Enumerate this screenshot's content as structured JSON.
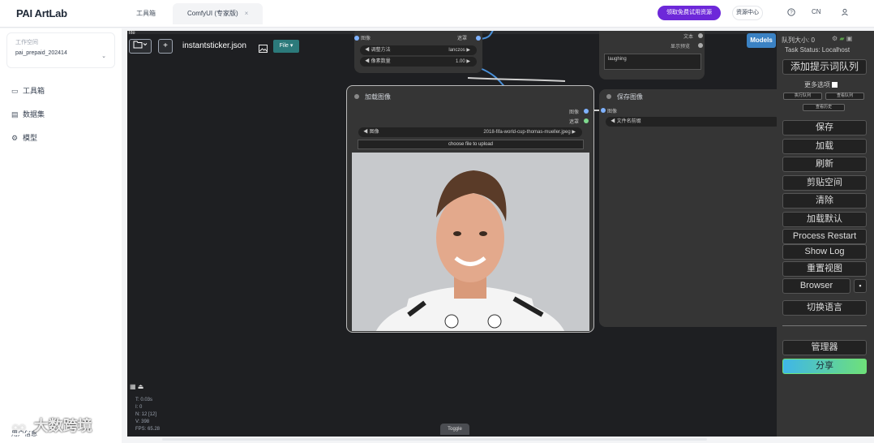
{
  "app": {
    "brand": "PAI ArtLab"
  },
  "tabs": [
    {
      "label": "工具箱"
    },
    {
      "label": "ComfyUI (专家版)",
      "close": "×"
    }
  ],
  "header": {
    "cta_label": "领取免费试用资源",
    "pill_label": "资源中心",
    "lang": "CN",
    "help_icon": "question-icon",
    "user_icon": "user-icon"
  },
  "sidebar": {
    "workspace_label": "工作空间",
    "workspace_value": "pai_prepaid_202414",
    "items": [
      {
        "label": "工具箱",
        "icon": "toolbox-icon"
      },
      {
        "label": "数据集",
        "icon": "dataset-icon"
      },
      {
        "label": "模型",
        "icon": "model-icon"
      }
    ],
    "footer_label": "用户信息"
  },
  "canvas": {
    "top_label": "lite",
    "filename": "instantsticker.json",
    "file_button": "File",
    "models_button": "Models",
    "node_top": {
      "output_label": "图像",
      "output_label_right": "遮罩",
      "widgets": [
        {
          "label": "调整方法",
          "value": "lanczos"
        },
        {
          "label": "像素数量",
          "value": "1.00"
        }
      ]
    },
    "node_right_top": {
      "lines": [
        "文本",
        "显示预览"
      ],
      "text": "laughing"
    },
    "node_load": {
      "title": "加载图像",
      "outputs": [
        "图像",
        "遮罩"
      ],
      "image_widget_label": "图像",
      "image_widget_value": "2018-fifa-world-cup-thomas-mueller.jpeg",
      "upload_label": "choose file to upload"
    },
    "node_save": {
      "title": "保存图像",
      "input": "图像",
      "prefix_label": "文件名前缀"
    },
    "stats": [
      "T: 0.03s",
      "I: 0",
      "N: 12 [12]",
      "V: 398",
      "FPS: 65.28"
    ],
    "bottom_toggle": "Toggle"
  },
  "right_panel": {
    "queue_label": "队列大小: 0",
    "task_status": "Task Status: Localhost",
    "queue_button": "添加提示词队列",
    "extra_options": "更多选项",
    "small_buttons": [
      "执行队列",
      "查看队列",
      "查看历史"
    ],
    "buttons": [
      "保存",
      "加载",
      "刷新",
      "剪贴空间",
      "清除",
      "加载默认",
      "Process Restart",
      "Show Log",
      "重置视图"
    ],
    "browser": "Browser",
    "switch_lang": "切换语言",
    "manager": "管理器",
    "share": "分享"
  },
  "watermark": "大数跨境"
}
